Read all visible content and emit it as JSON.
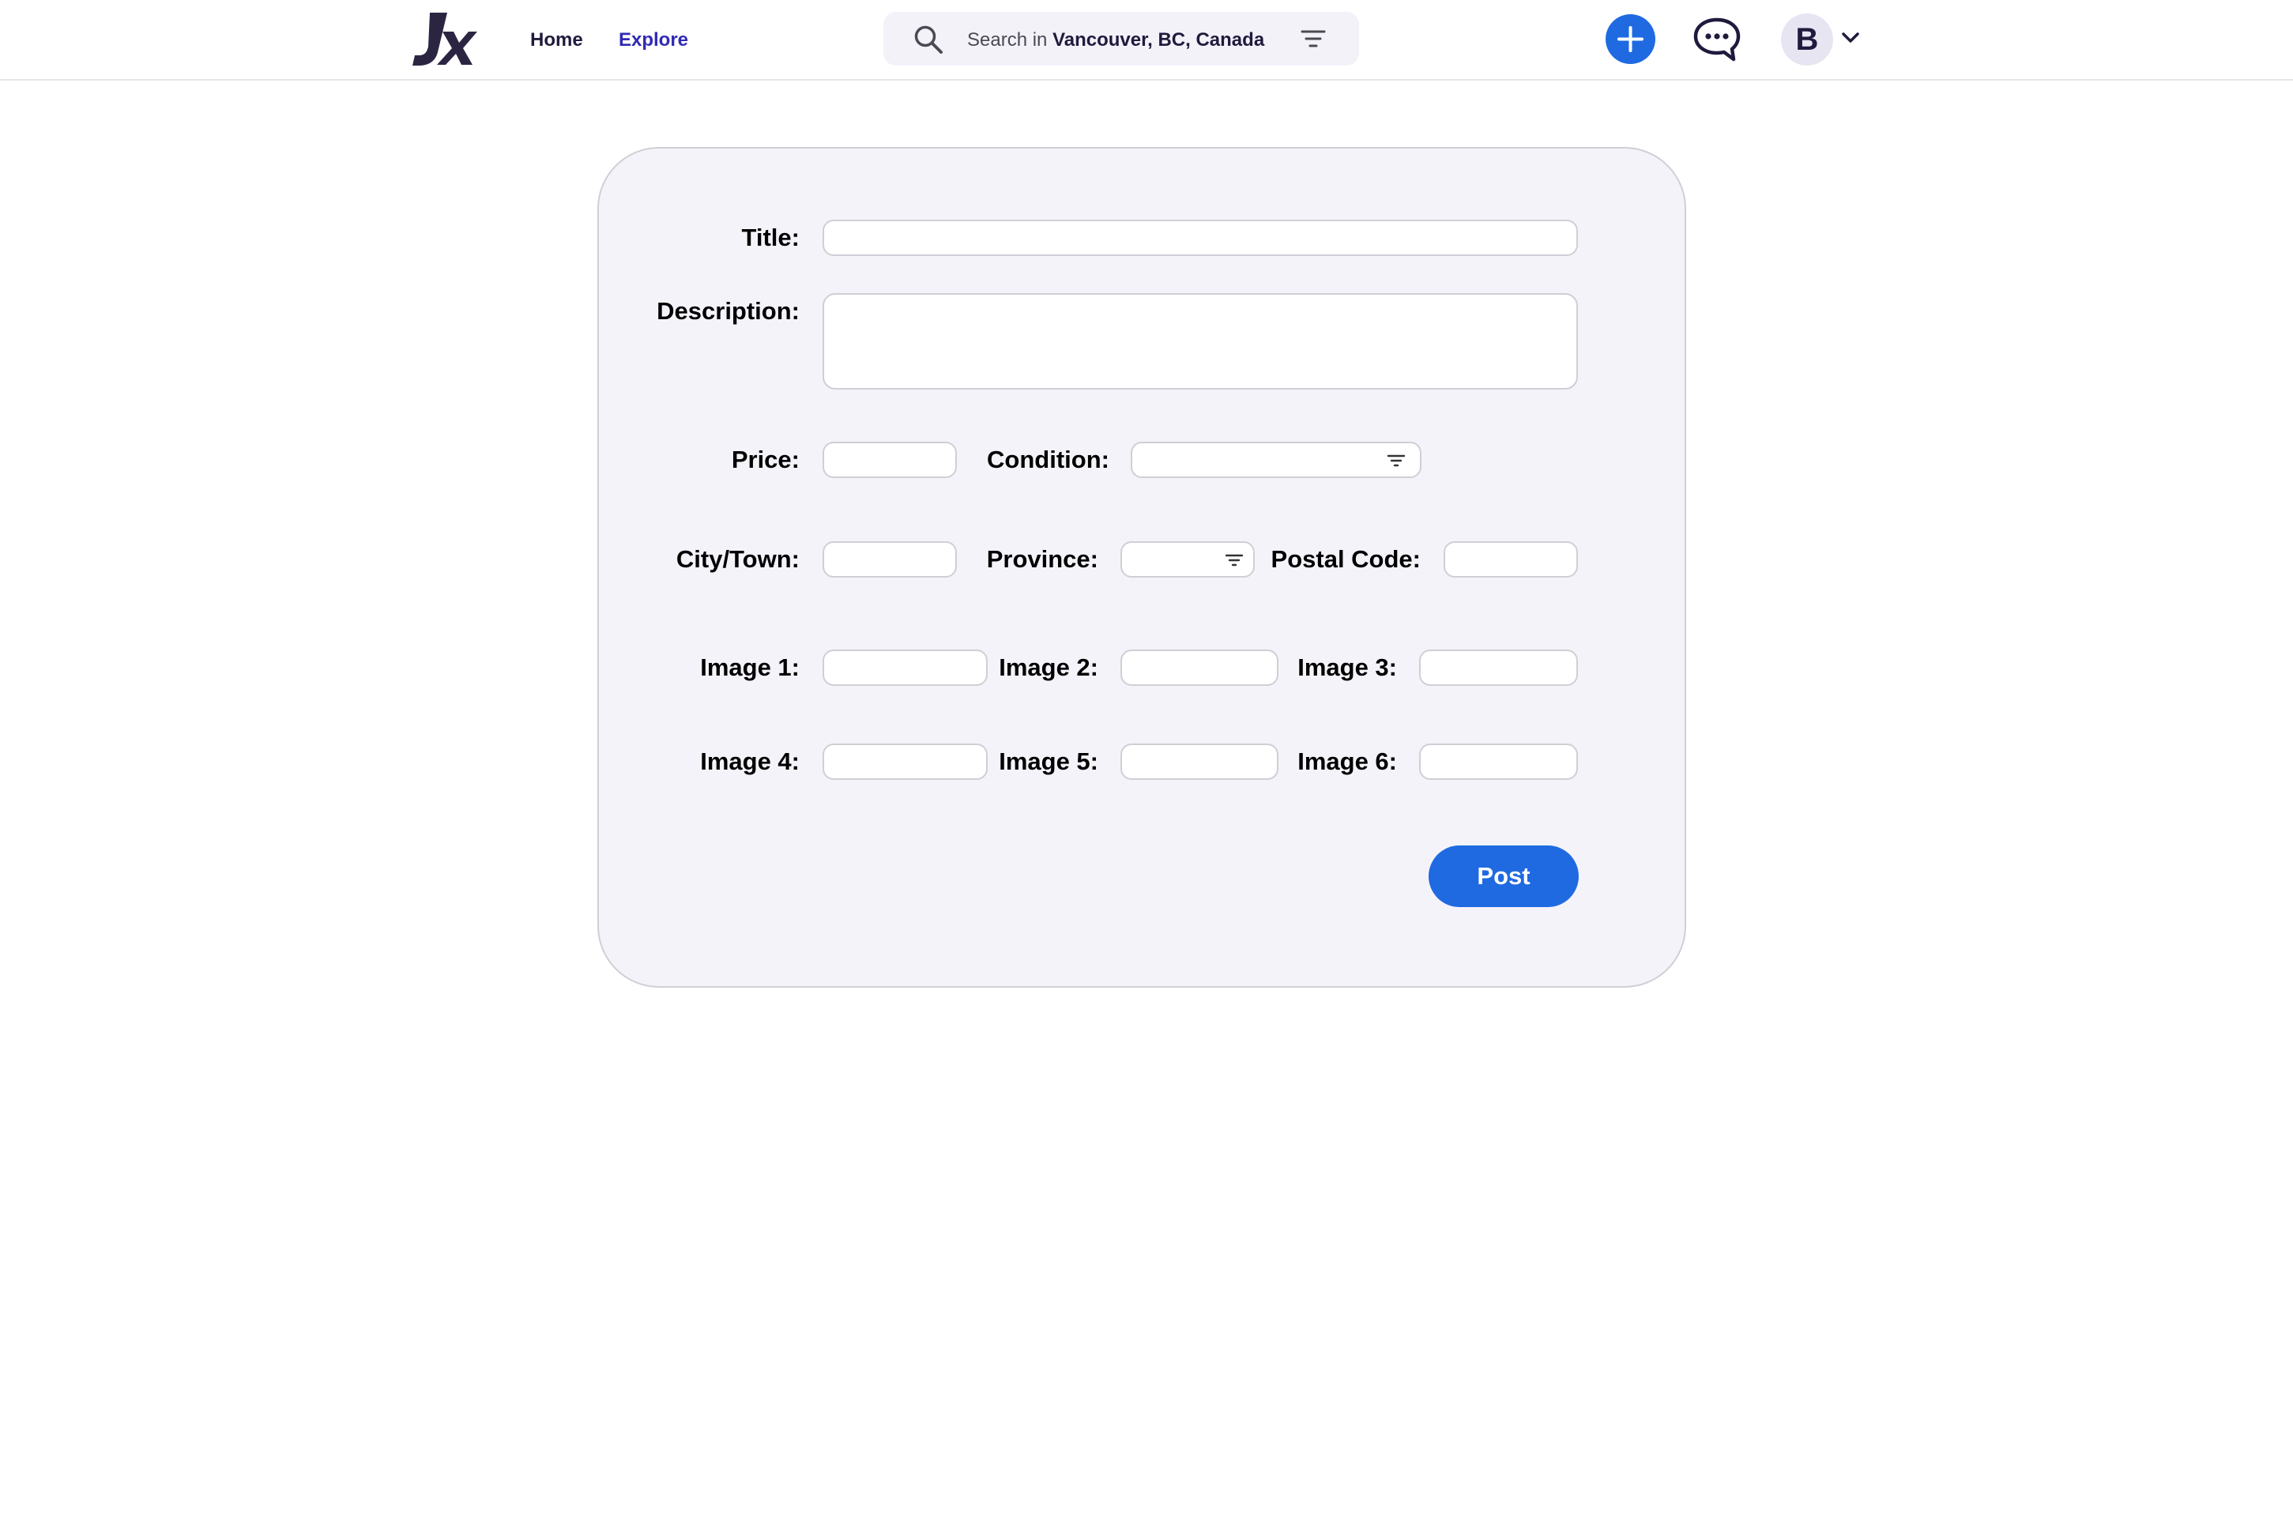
{
  "brand": {
    "logo_text": "Jx"
  },
  "nav": {
    "home": "Home",
    "explore": "Explore"
  },
  "search": {
    "prefix": "Search in ",
    "location": "Vancouver, BC, Canada"
  },
  "user": {
    "avatar_initial": "B"
  },
  "colors": {
    "accent": "#1f6ae1",
    "brand_dark": "#1f1b3d",
    "explore_link": "#2f2ab5",
    "card_background": "#f5f3fa",
    "field_border": "#cfcfd6"
  },
  "icons": {
    "search": "search-icon",
    "filter": "filter-icon",
    "add": "plus-icon",
    "chat": "chat-bubble-icon",
    "dropdown": "chevron-down-icon"
  },
  "form": {
    "title_label": "Title:",
    "title_value": "",
    "description_label": "Description:",
    "description_value": "",
    "price_label": "Price:",
    "price_value": "",
    "condition_label": "Condition:",
    "condition_value": "",
    "city_label": "City/Town:",
    "city_value": "",
    "province_label": "Province:",
    "province_value": "",
    "postal_label": "Postal Code:",
    "postal_value": "",
    "images": [
      {
        "label": "Image 1:",
        "value": ""
      },
      {
        "label": "Image 2:",
        "value": ""
      },
      {
        "label": "Image 3:",
        "value": ""
      },
      {
        "label": "Image 4:",
        "value": ""
      },
      {
        "label": "Image 5:",
        "value": ""
      },
      {
        "label": "Image 6:",
        "value": ""
      }
    ],
    "post_label": "Post"
  }
}
